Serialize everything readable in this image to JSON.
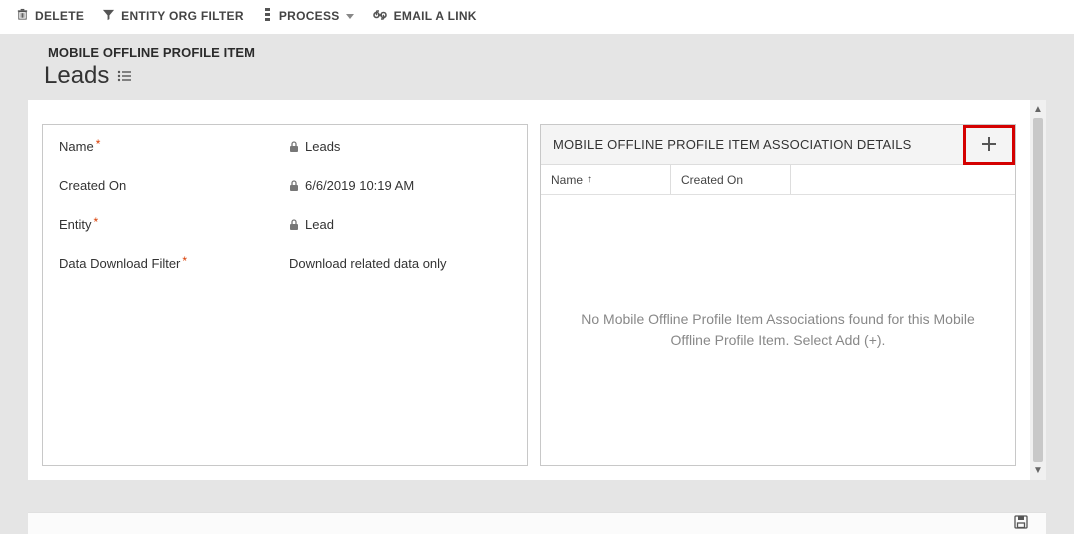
{
  "commands": {
    "delete": "DELETE",
    "entity_org_filter": "ENTITY ORG FILTER",
    "process": "PROCESS",
    "email_a_link": "EMAIL A LINK"
  },
  "breadcrumb": "MOBILE OFFLINE PROFILE ITEM",
  "page_title": "Leads",
  "form": {
    "name_label": "Name",
    "name_value": "Leads",
    "created_on_label": "Created On",
    "created_on_value": "6/6/2019  10:19 AM",
    "entity_label": "Entity",
    "entity_value": "Lead",
    "ddf_label": "Data Download Filter",
    "ddf_value": "Download related data only"
  },
  "assoc": {
    "title": "MOBILE OFFLINE PROFILE ITEM ASSOCIATION DETAILS",
    "col_name": "Name",
    "col_created_on": "Created On",
    "empty_message": "No Mobile Offline Profile Item Associations found for this Mobile Offline Profile Item. Select Add (+)."
  }
}
